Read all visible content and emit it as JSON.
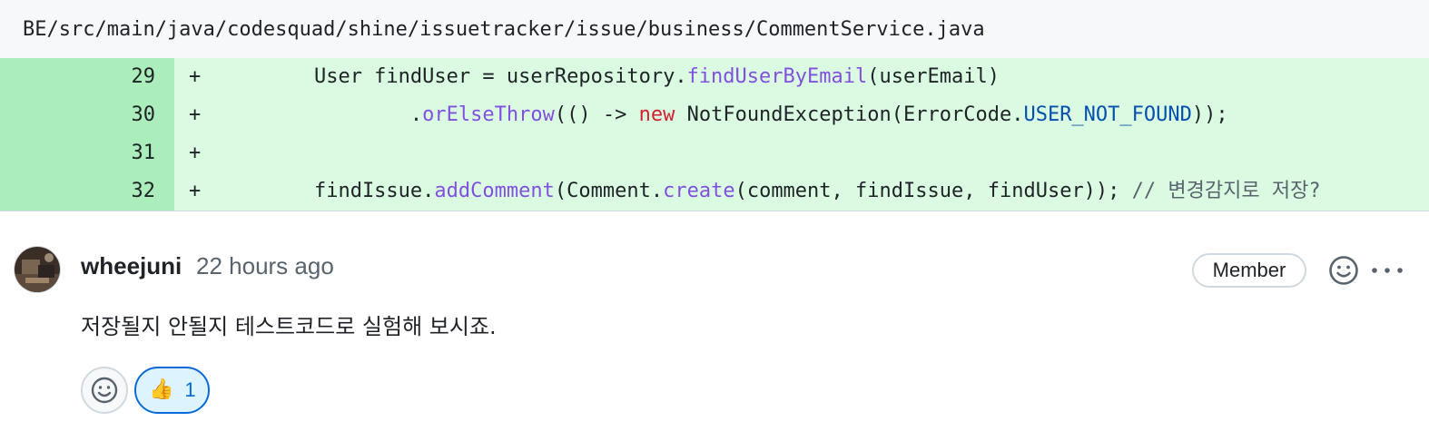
{
  "file": {
    "path": "BE/src/main/java/codesquad/shine/issuetracker/issue/business/CommentService.java"
  },
  "diff_lines": [
    {
      "line": "29",
      "sign": "+",
      "tokens": [
        {
          "t": "        User findUser = userRepository.",
          "c": ""
        },
        {
          "t": "findUserByEmail",
          "c": "fn"
        },
        {
          "t": "(userEmail)",
          "c": ""
        }
      ]
    },
    {
      "line": "30",
      "sign": "+",
      "tokens": [
        {
          "t": "                .",
          "c": ""
        },
        {
          "t": "orElseThrow",
          "c": "fn"
        },
        {
          "t": "(() -> ",
          "c": ""
        },
        {
          "t": "new",
          "c": "kw"
        },
        {
          "t": " NotFoundException(ErrorCode.",
          "c": ""
        },
        {
          "t": "USER_NOT_FOUND",
          "c": "const"
        },
        {
          "t": "));",
          "c": ""
        }
      ]
    },
    {
      "line": "31",
      "sign": "+",
      "tokens": []
    },
    {
      "line": "32",
      "sign": "+",
      "tokens": [
        {
          "t": "        findIssue.",
          "c": ""
        },
        {
          "t": "addComment",
          "c": "fn"
        },
        {
          "t": "(Comment.",
          "c": ""
        },
        {
          "t": "create",
          "c": "fn"
        },
        {
          "t": "(comment, findIssue, findUser)); ",
          "c": ""
        },
        {
          "t": "// 변경감지로 저장?",
          "c": "cmt"
        }
      ]
    }
  ],
  "comment": {
    "author": "wheejuni",
    "timestamp": "22 hours ago",
    "badge": "Member",
    "body": "저장될지 안될지 테스트코드로 실험해 보시죠.",
    "reactions": [
      {
        "emoji": "👍",
        "icon": "thumbs-up-icon",
        "count": "1"
      }
    ]
  },
  "icons": {
    "add_reaction": "smiley-icon",
    "more": "kebab-horizontal-icon",
    "avatar": "user-avatar"
  },
  "colors": {
    "addition_line_bg": "#dafbe1",
    "addition_number_bg": "#aceebb",
    "function": "#8250df",
    "keyword": "#cf222e",
    "constant": "#0550ae",
    "comment": "#59636e",
    "reaction_active": "#0969da"
  }
}
